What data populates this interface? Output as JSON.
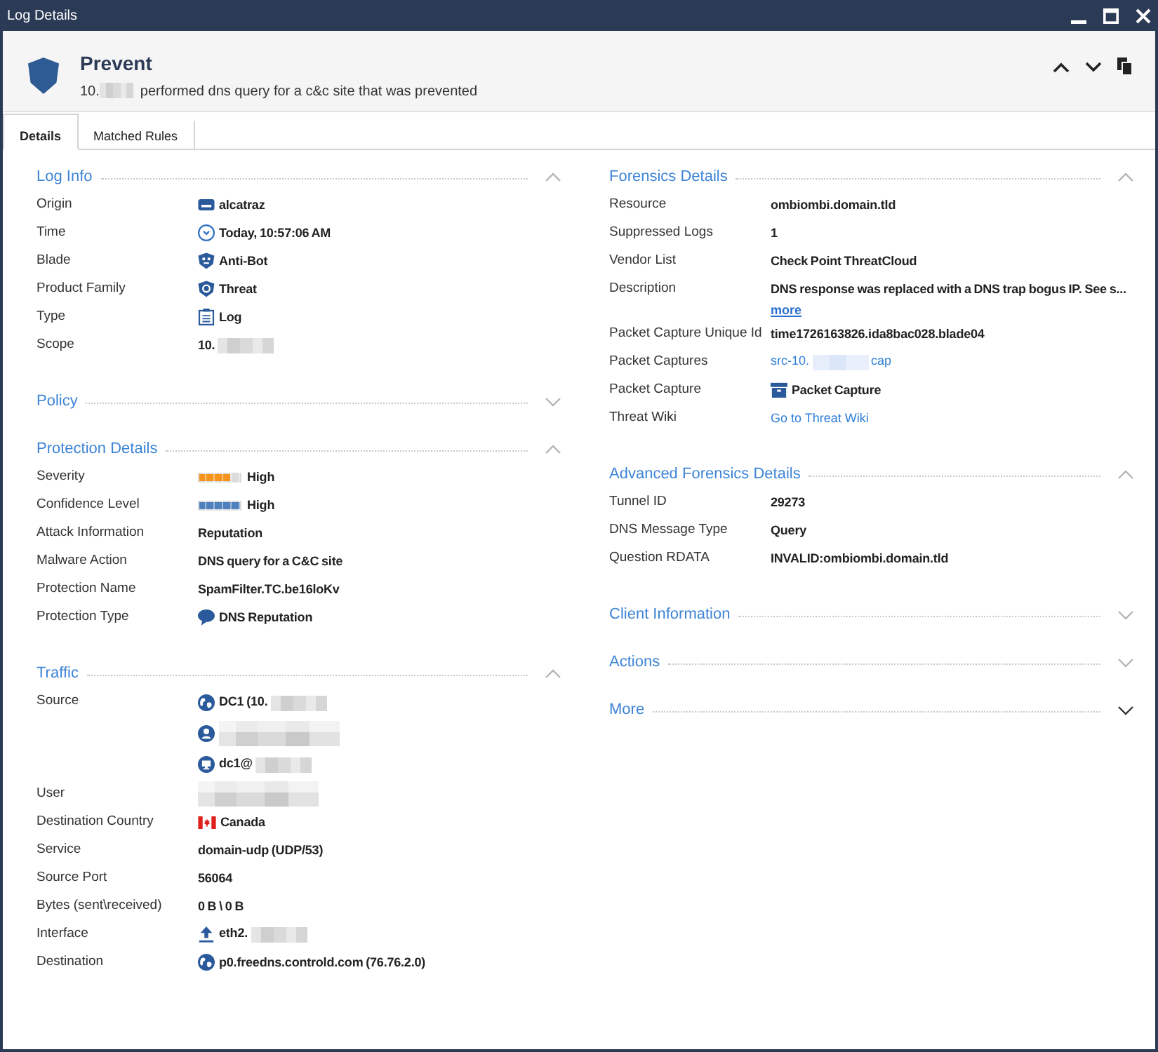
{
  "window": {
    "title": "Log Details"
  },
  "header": {
    "title": "Prevent",
    "subtitle": [
      {
        "kind": "text",
        "text": "10."
      },
      {
        "kind": "blur"
      },
      {
        "kind": "text",
        "text": "performed dns query for a c&c site that was prevented"
      }
    ]
  },
  "tabs": [
    {
      "label": "Details",
      "selected": true
    },
    {
      "label": "Matched Rules",
      "selected": false
    }
  ],
  "columns": [
    {
      "sections": [
        {
          "title": "Log Info",
          "expanded": true,
          "hovered": false,
          "rows": [
            {
              "label": "Origin",
              "kind": "gateway",
              "text": "alcatraz"
            },
            {
              "label": "Time",
              "kind": "time",
              "text": "Today, 10:57:06 AM"
            },
            {
              "label": "Blade",
              "kind": "blade",
              "text": "Anti-Bot"
            },
            {
              "label": "Product Family",
              "kind": "family",
              "text": "Threat"
            },
            {
              "label": "Type",
              "kind": "log_type",
              "text": "Log"
            },
            {
              "label": "Scope",
              "kind": "text",
              "parts": [
                {
                  "kind": "text",
                  "text": "10."
                },
                {
                  "kind": "blur"
                }
              ]
            }
          ]
        },
        {
          "title": "Policy",
          "expanded": false,
          "hovered": false
        },
        {
          "title": "Protection Details",
          "expanded": true,
          "hovered": false,
          "rows": [
            {
              "label": "Severity",
              "kind": "meter",
              "level": 0.75,
              "color": "#f7941d",
              "text": "High"
            },
            {
              "label": "Confidence Level",
              "kind": "meter",
              "level": 1,
              "color": "#4f81bd",
              "text": "High"
            },
            {
              "label": "Attack Information",
              "kind": "text",
              "text": "Reputation"
            },
            {
              "label": "Malware Action",
              "kind": "text",
              "text": "DNS query for a C&C site"
            },
            {
              "label": "Protection Name",
              "kind": "text",
              "text": "SpamFilter.TC.be16loKv"
            },
            {
              "label": "Protection Type",
              "kind": "protection_type",
              "text": "DNS Reputation"
            }
          ]
        },
        {
          "title": "Traffic",
          "expanded": true,
          "hovered": false,
          "rows": [
            {
              "label": "Source",
              "lines": [
                {
                  "kind": "network_object",
                  "parts": [
                    {
                      "kind": "text",
                      "text": "DC1 (10."
                    },
                    {
                      "kind": "blur"
                    }
                  ]
                },
                {
                  "kind": "user",
                  "parts": [
                    {
                      "kind": "blur_tall"
                    }
                  ]
                },
                {
                  "kind": "machine",
                  "parts": [
                    {
                      "kind": "text",
                      "text": "dc1@"
                    },
                    {
                      "kind": "blur"
                    }
                  ]
                }
              ]
            },
            {
              "label": "User",
              "kind": "text",
              "parts": [
                {
                  "kind": "blur_tall"
                }
              ]
            },
            {
              "label": "Destination Country",
              "kind": "country",
              "text": "Canada"
            },
            {
              "label": "Service",
              "kind": "text",
              "text": "domain-udp (UDP/53)"
            },
            {
              "label": "Source Port",
              "kind": "text",
              "text": "56064"
            },
            {
              "label": "Bytes (sent\\received)",
              "kind": "text",
              "text": "0 B \\ 0 B"
            },
            {
              "label": "Interface",
              "kind": "interface",
              "parts": [
                {
                  "kind": "text",
                  "text": "eth2."
                },
                {
                  "kind": "blur"
                }
              ]
            },
            {
              "label": "Destination",
              "kind": "network_object",
              "text": "p0.freedns.controld.com (76.76.2.0)"
            }
          ]
        }
      ]
    },
    {
      "sections": [
        {
          "title": "Forensics Details",
          "expanded": true,
          "hovered": false,
          "rows": [
            {
              "label": "Resource",
              "kind": "text",
              "text": "ombiombi.domain.tld"
            },
            {
              "label": "Suppressed Logs",
              "kind": "text",
              "text": "1"
            },
            {
              "label": "Vendor List",
              "kind": "text",
              "text": "Check Point ThreatCloud"
            },
            {
              "label": "Description",
              "lines": [
                {
                  "kind": "text",
                  "text": "DNS response was replaced with a DNS trap bogus IP. See s..."
                },
                {
                  "kind": "expand_link",
                  "text": "more"
                }
              ]
            },
            {
              "label": "Packet Capture Unique Id",
              "kind": "text",
              "text": "time1726163826.ida8bac028.blade04"
            },
            {
              "label": "Packet Captures",
              "kind": "link",
              "parts": [
                {
                  "kind": "text",
                  "text": "src-10."
                },
                {
                  "kind": "blur"
                },
                {
                  "kind": "text",
                  "text": "cap"
                }
              ]
            },
            {
              "label": "Packet Capture",
              "kind": "capture",
              "text": "Packet Capture"
            },
            {
              "label": "Threat Wiki",
              "kind": "link",
              "text": "Go to Threat Wiki"
            }
          ]
        },
        {
          "title": "Advanced Forensics Details",
          "expanded": true,
          "hovered": false,
          "rows": [
            {
              "label": "Tunnel ID",
              "kind": "text",
              "text": "29273"
            },
            {
              "label": "DNS Message Type",
              "kind": "text",
              "text": "Query"
            },
            {
              "label": "Question RDATA",
              "kind": "text",
              "text": "INVALID:ombiombi.domain.tld"
            }
          ]
        },
        {
          "title": "Client Information",
          "expanded": false,
          "hovered": false
        },
        {
          "title": "Actions",
          "expanded": false,
          "hovered": false
        },
        {
          "title": "More",
          "expanded": false,
          "hovered": true
        }
      ]
    }
  ]
}
